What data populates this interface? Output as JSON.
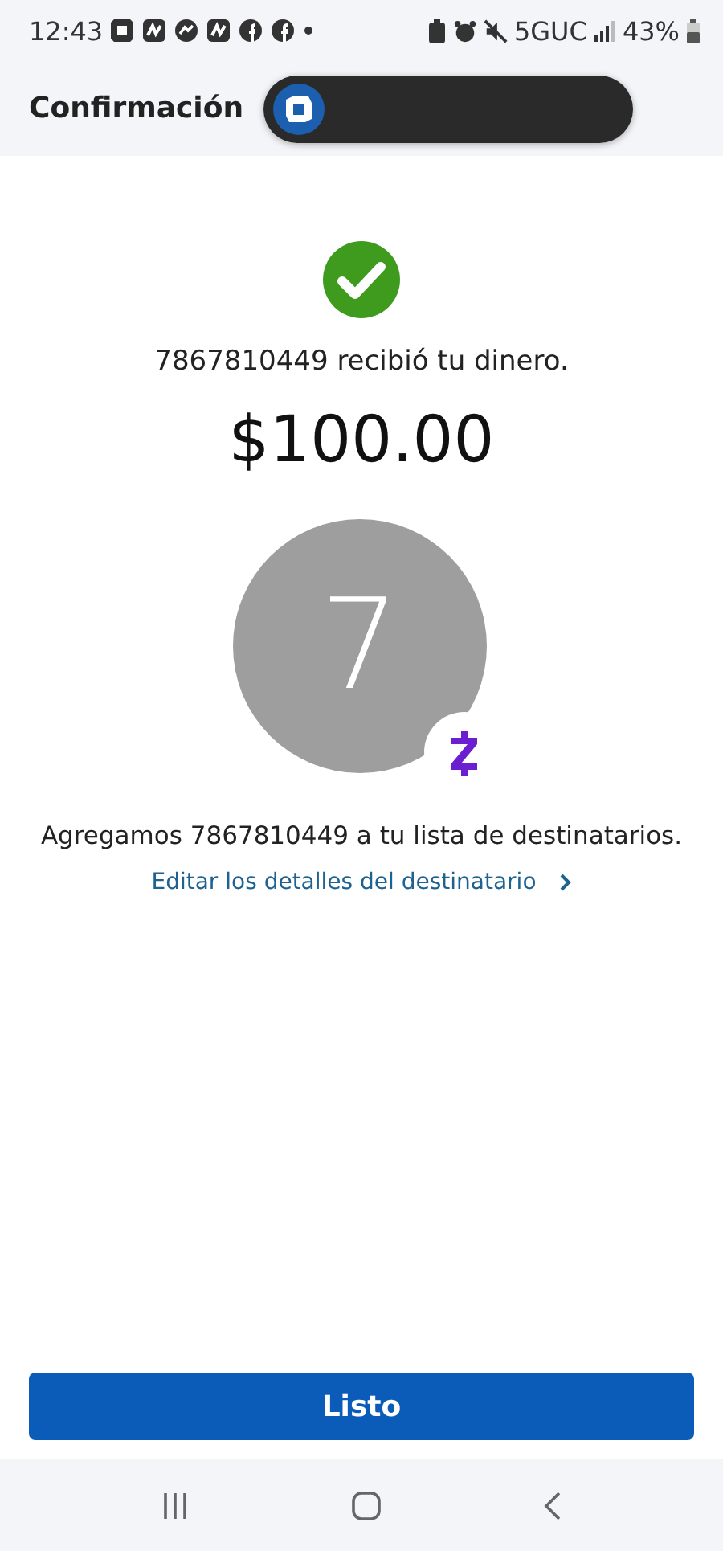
{
  "status_bar": {
    "time": "12:43",
    "network": "5GUC",
    "battery": "43%"
  },
  "header": {
    "title": "Confirmación"
  },
  "confirmation": {
    "message": "7867810449 recibió tu dinero.",
    "amount": "$100.00",
    "avatar_initial": "7",
    "added_note": "Agregamos 7867810449 a tu lista de destinatarios.",
    "edit_link": "Editar los detalles del destinatario"
  },
  "primary_button": "Listo"
}
